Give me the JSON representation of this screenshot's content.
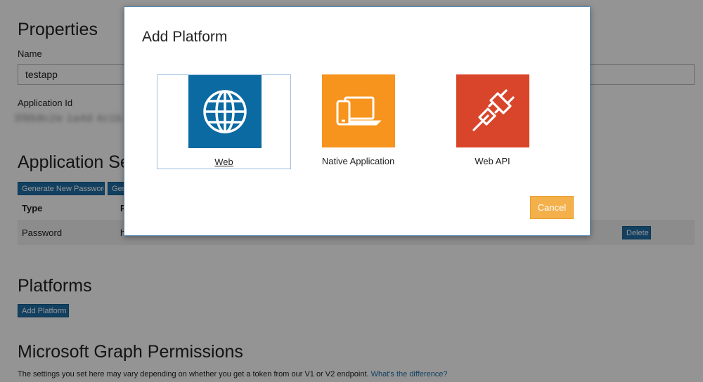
{
  "properties": {
    "title": "Properties",
    "name_label": "Name",
    "name_value": "testapp",
    "app_id_label": "Application Id",
    "app_id_value": "3f8b8c2e 1a4d 4c1b"
  },
  "secrets": {
    "title": "Application Se",
    "generate_password": "Generate New Password",
    "generate_other": "Gen",
    "col_type": "Type",
    "col_second": "P",
    "row_type": "Password",
    "row_second": "h",
    "delete_label": "Delete"
  },
  "platforms": {
    "title": "Platforms",
    "add_button": "Add Platform"
  },
  "graph": {
    "title": "Microsoft Graph Permissions",
    "note": "The settings you set here may vary depending on whether you get a token from our V1 or V2 endpoint.",
    "link": "What's the difference?"
  },
  "dialog": {
    "title": "Add Platform",
    "tiles": [
      {
        "label": "Web",
        "icon": "globe-icon",
        "color": "#0b6aa2"
      },
      {
        "label": "Native Application",
        "icon": "devices-icon",
        "color": "#f7941d"
      },
      {
        "label": "Web API",
        "icon": "plug-icon",
        "color": "#d9452a"
      }
    ],
    "cancel": "Cancel"
  },
  "colors": {
    "accent_blue": "#1f6fa8",
    "cancel_orange": "#f4b04a"
  }
}
